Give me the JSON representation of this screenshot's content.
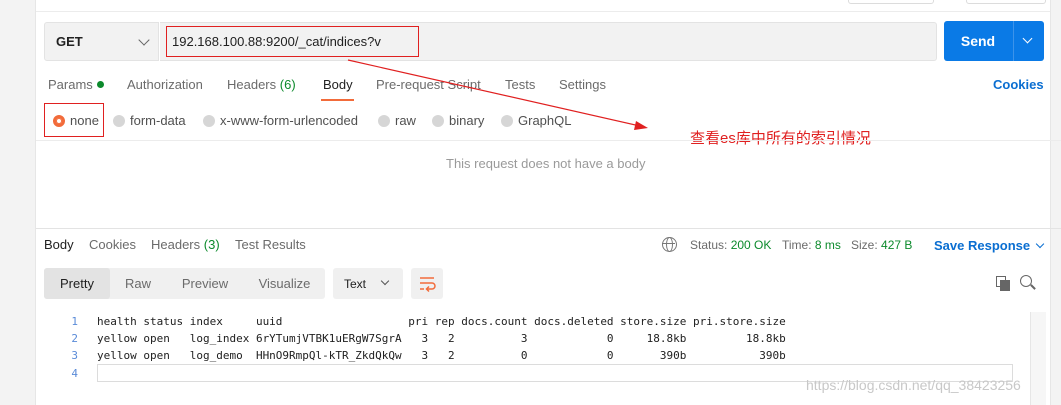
{
  "request": {
    "method": "GET",
    "url": "192.168.100.88:9200/_cat/indices?v",
    "send_label": "Send"
  },
  "request_tabs": [
    {
      "label": "Params",
      "active": false
    },
    {
      "label": "Authorization",
      "active": false
    },
    {
      "label": "Headers",
      "count": "(6)",
      "active": false
    },
    {
      "label": "Body",
      "active": true
    },
    {
      "label": "Pre-request Script",
      "active": false
    },
    {
      "label": "Tests",
      "active": false
    },
    {
      "label": "Settings",
      "active": false
    }
  ],
  "cookies_label": "Cookies",
  "body_types": [
    {
      "label": "none",
      "checked": true
    },
    {
      "label": "form-data",
      "checked": false
    },
    {
      "label": "x-www-form-urlencoded",
      "checked": false
    },
    {
      "label": "raw",
      "checked": false
    },
    {
      "label": "binary",
      "checked": false
    },
    {
      "label": "GraphQL",
      "checked": false
    }
  ],
  "annotation_text": "查看es库中所有的索引情况",
  "no_body_message": "This request does not have a body",
  "response_tabs": [
    {
      "label": "Body",
      "active": true
    },
    {
      "label": "Cookies",
      "active": false
    },
    {
      "label": "Headers",
      "count": "(3)",
      "active": false
    },
    {
      "label": "Test Results",
      "active": false
    }
  ],
  "response_meta": {
    "status_label": "Status:",
    "status_value": "200 OK",
    "time_label": "Time:",
    "time_value": "8 ms",
    "size_label": "Size:",
    "size_value": "427 B",
    "save_label": "Save Response"
  },
  "view_modes": [
    "Pretty",
    "Raw",
    "Preview",
    "Visualize"
  ],
  "format_label": "Text",
  "code_lines": [
    {
      "n": "1",
      "text": "health status index     uuid                   pri rep docs.count docs.deleted store.size pri.store.size"
    },
    {
      "n": "2",
      "text": "yellow open   log_index 6rYTumjVTBK1uERgW7SgrA   3   2          3            0     18.8kb         18.8kb"
    },
    {
      "n": "3",
      "text": "yellow open   log_demo  HHnO9RmpQl-kTR_ZkdQkQw   3   2          0            0       390b           390b"
    },
    {
      "n": "4",
      "text": ""
    }
  ],
  "watermark": "https://blog.csdn.net/qq_38423256",
  "colors": {
    "accent_orange": "#f26b3a",
    "send_blue": "#0a7ae6",
    "status_green": "#0c8a2c",
    "annotation_red": "#e02020"
  }
}
